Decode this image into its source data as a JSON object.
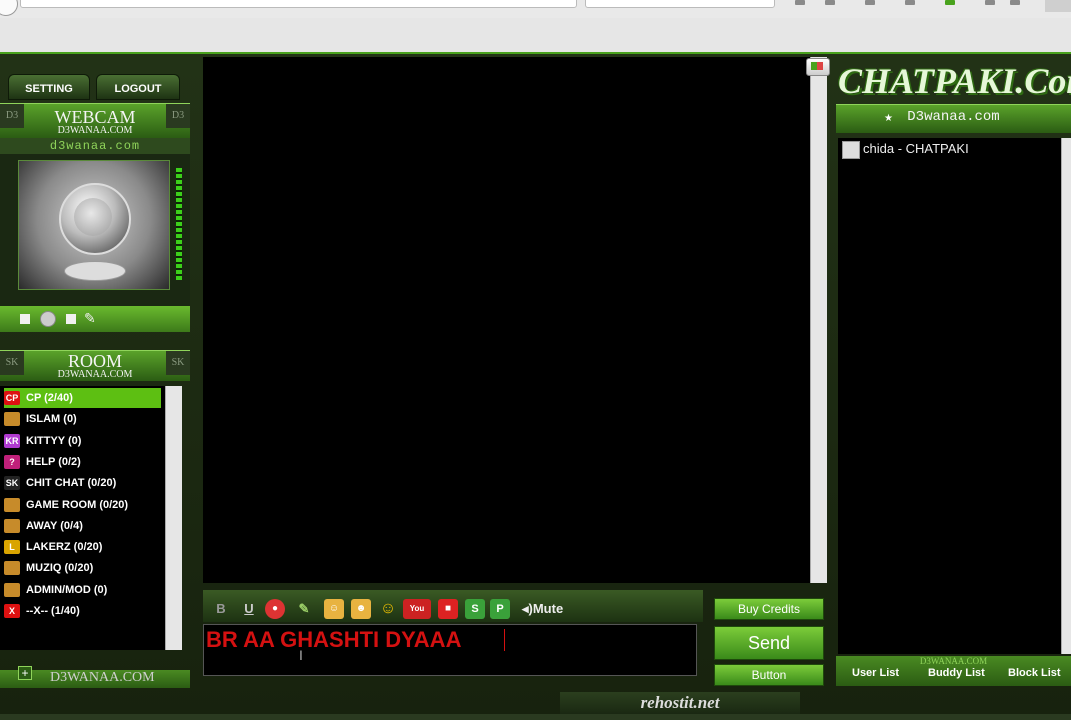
{
  "browser": {},
  "left": {
    "setting_label": "SETTING",
    "logout_label": "LOGOUT",
    "webcam_title": "WEBCAM",
    "webcam_sub": "D3WANAA.COM",
    "corner": "D3",
    "brand_strip": "d3wanaa.com",
    "room_title": "ROOM",
    "room_sub": "D3WANAA.COM",
    "room_corner": "SK",
    "rooms": [
      {
        "label": "CP (2/40)",
        "icon": "CP",
        "color": "#d11",
        "selected": true
      },
      {
        "label": "ISLAM (0)",
        "icon": "",
        "color": "#c78b2a"
      },
      {
        "label": "KITTYY (0)",
        "icon": "KR",
        "color": "#b03ad0"
      },
      {
        "label": "HELP (0/2)",
        "icon": "?",
        "color": "#c0207a"
      },
      {
        "label": "CHIT CHAT (0/20)",
        "icon": "SK",
        "color": "#222"
      },
      {
        "label": "GAME ROOM (0/20)",
        "icon": "",
        "color": "#c78b2a"
      },
      {
        "label": "AWAY (0/4)",
        "icon": "",
        "color": "#c78b2a"
      },
      {
        "label": "LAKERZ (0/20)",
        "icon": "L",
        "color": "#d9a400"
      },
      {
        "label": "MUZIQ (0/20)",
        "icon": "",
        "color": "#c78b2a"
      },
      {
        "label": "ADMIN/MOD (0)",
        "icon": "",
        "color": "#c78b2a"
      },
      {
        "label": "--X-- (1/40)",
        "icon": "X",
        "color": "#d11"
      }
    ],
    "footer": "D3WANAA.COM"
  },
  "center": {
    "mute_label": "◂)Mute",
    "message_value": "BR AA GHASHTI DYAAA",
    "buy_credits": "Buy Credits",
    "send": "Send",
    "button": "Button",
    "footer_watermark": "rehostit.net"
  },
  "right": {
    "logo": "CHATPAKI.Com",
    "sub": "D3wanaa.com",
    "users": [
      "chida - CHATPAKI"
    ],
    "tabs": [
      "User List",
      "Buddy List",
      "Block List"
    ],
    "tab_watermark": "D3WANAA.COM"
  }
}
